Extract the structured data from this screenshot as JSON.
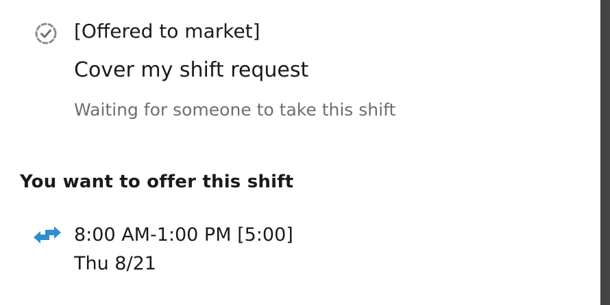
{
  "request": {
    "status_label": "[Offered to market]",
    "title": "Cover my shift request",
    "status_text": "Waiting for someone to take this shift"
  },
  "offer": {
    "heading": "You want to offer this shift",
    "time_range": "8:00 AM-1:00 PM [5:00]",
    "date": "Thu 8/21"
  },
  "icons": {
    "status": "pending-check-icon",
    "swap": "swap-arrows-icon",
    "accent_color": "#2d8fcf"
  }
}
